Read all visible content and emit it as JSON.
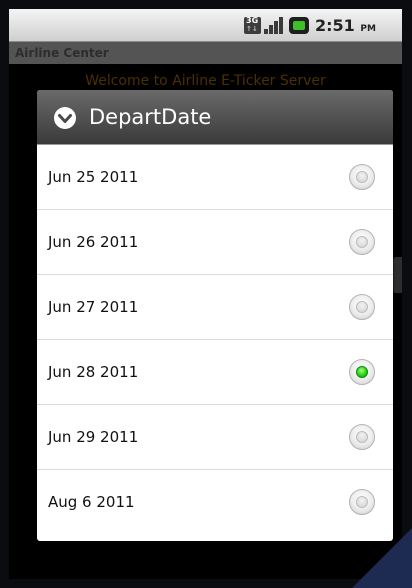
{
  "status_bar": {
    "network_label": "3G",
    "network_arrows": "↑↓",
    "time": "2:51",
    "ampm": "PM",
    "icons": [
      "3g-icon",
      "signal-icon",
      "battery-charging-icon"
    ]
  },
  "app": {
    "title": "Airline Center",
    "welcome": "Welcome to Airline E-Ticker Server"
  },
  "dialog": {
    "title": "DepartDate",
    "icon": "dropdown-circle-icon",
    "options": [
      {
        "label": "Jun 25 2011",
        "selected": false
      },
      {
        "label": "Jun 26 2011",
        "selected": false
      },
      {
        "label": "Jun 27 2011",
        "selected": false
      },
      {
        "label": "Jun 28 2011",
        "selected": true
      },
      {
        "label": "Jun 29 2011",
        "selected": false
      },
      {
        "label": "Aug 6 2011",
        "selected": false
      }
    ]
  },
  "colors": {
    "selected_radio": "#1fcf12",
    "dialog_header": "#4a4a4a",
    "welcome_text": "#4a3000"
  }
}
